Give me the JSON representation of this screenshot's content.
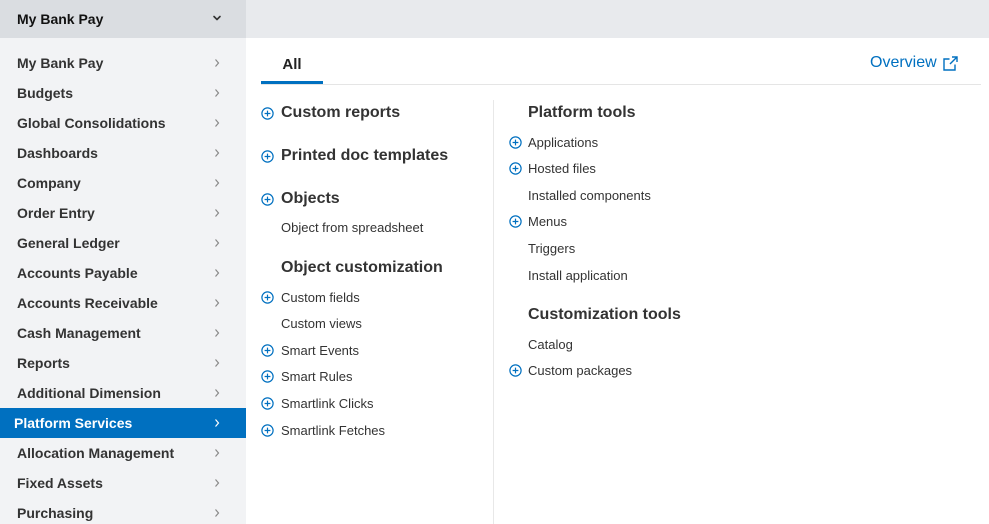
{
  "header": {
    "company": "My Bank Pay"
  },
  "sidebar": {
    "items": [
      {
        "label": "My Bank Pay"
      },
      {
        "label": "Budgets"
      },
      {
        "label": "Global Consolidations"
      },
      {
        "label": "Dashboards"
      },
      {
        "label": "Company"
      },
      {
        "label": "Order Entry"
      },
      {
        "label": "General Ledger"
      },
      {
        "label": "Accounts Payable"
      },
      {
        "label": "Accounts Receivable"
      },
      {
        "label": "Cash Management"
      },
      {
        "label": "Reports"
      },
      {
        "label": "Additional Dimension"
      },
      {
        "label": "Platform Services",
        "active": true
      },
      {
        "label": "Allocation Management"
      },
      {
        "label": "Fixed Assets"
      },
      {
        "label": "Purchasing"
      }
    ]
  },
  "main": {
    "tab_label": "All",
    "overview_label": "Overview",
    "left": {
      "custom_reports": "Custom reports",
      "printed_doc_templates": "Printed doc templates",
      "objects": "Objects",
      "object_from_spreadsheet": "Object from spreadsheet",
      "object_customization": "Object customization",
      "custom_fields": "Custom fields",
      "custom_views": "Custom views",
      "smart_events": "Smart Events",
      "smart_rules": "Smart Rules",
      "smartlink_clicks": "Smartlink Clicks",
      "smartlink_fetches": "Smartlink Fetches"
    },
    "right": {
      "platform_tools": "Platform tools",
      "applications": "Applications",
      "hosted_files": "Hosted files",
      "installed_components": "Installed components",
      "menus": "Menus",
      "triggers": "Triggers",
      "install_application": "Install application",
      "customization_tools": "Customization tools",
      "catalog": "Catalog",
      "custom_packages": "Custom packages"
    }
  },
  "colors": {
    "accent": "#0070c0",
    "sidebar_bg": "#f2f3f5",
    "header_bg": "#e8eaed"
  },
  "icons": {
    "add": "plus-circle-icon",
    "external": "external-link-icon",
    "chevron": "chevron-right-icon"
  }
}
